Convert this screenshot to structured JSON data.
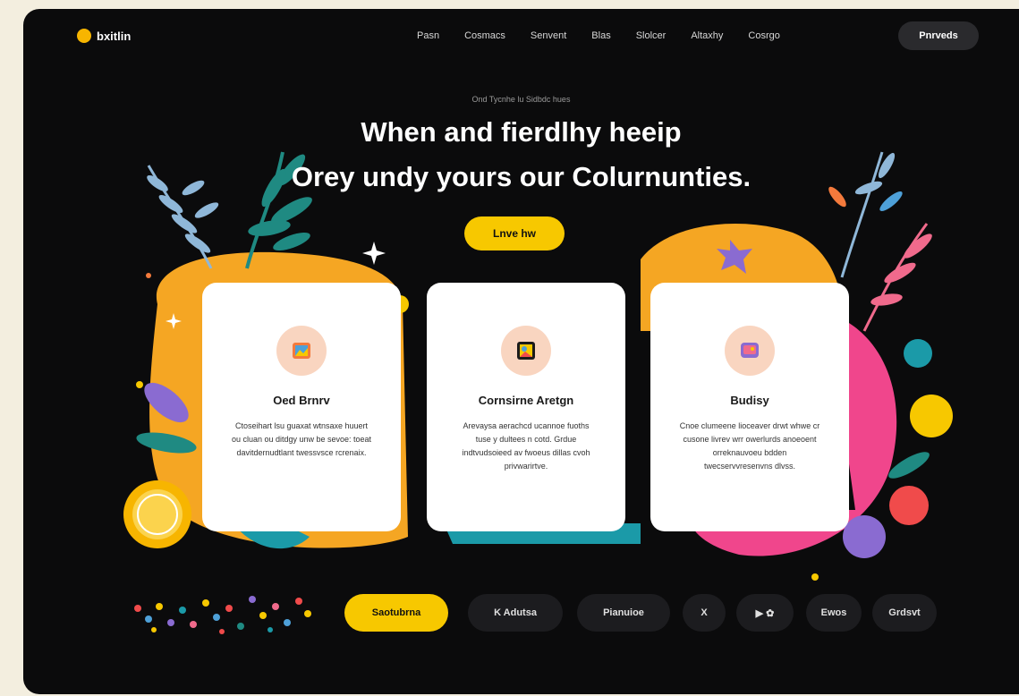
{
  "header": {
    "logo_text": "bxitlin",
    "nav": [
      "Pasn",
      "Cosmacs",
      "Senvent",
      "Blas",
      "Slolcer",
      "Altaxhy",
      "Cosrgo"
    ],
    "top_button": "Pnrveds"
  },
  "hero": {
    "eyebrow": "Ond Tycnhe lu Sidbdc hues",
    "headline_line1": "When and fierdlhy heeip",
    "headline_line2": "Orey undy yours our Colurnunties.",
    "cta": "Lnve hw"
  },
  "cards": [
    {
      "title": "Oed Brnrv",
      "body": "Ctoseihart lsu guaxat wtnsaxe huuert ou cluan ou ditdgy unw be sevoe: toeat davitdernudtlant twessvsce rcrenaix."
    },
    {
      "title": "Cornsirne Aretgn",
      "body": "Arevaysa aerachcd ucannoe fuoths tuse y dultees n cotd. Grdue indtvudsoieed av fwoeus dillas cvoh privwarirtve."
    },
    {
      "title": "Budisy",
      "body": "Cnoe clumeene lioceaver drwt whwe cr cusone livrev wrr owerlurds anoeoent orreknauvoeu bdden twecservvresenvns dlvss."
    }
  ],
  "bottom_bar": {
    "primary": "Saotubrna",
    "items": [
      "K Adutsa",
      "Pianuioe",
      "X",
      "▶ ✿",
      "Ewos",
      "Grdsvt"
    ]
  },
  "colors": {
    "background": "#0b0b0c",
    "accent_yellow": "#f7c800",
    "orange_blob": "#f5a623",
    "pink_blob": "#f0468c",
    "teal": "#1b9aa8"
  },
  "icons": {
    "card1": "image-icon",
    "card2": "picture-icon",
    "card3": "chat-image-icon"
  }
}
